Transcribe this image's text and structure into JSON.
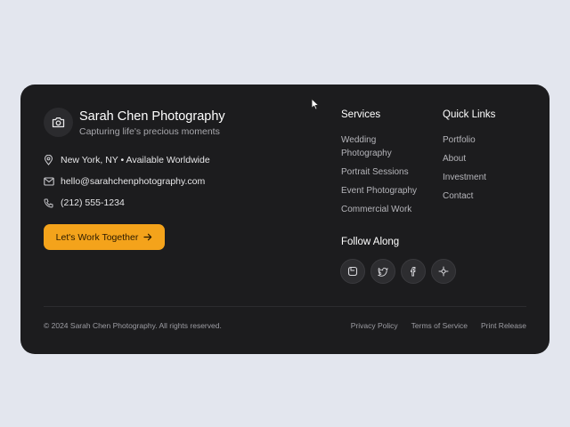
{
  "brand": {
    "icon": "camera-icon",
    "name": "Sarah Chen Photography",
    "tagline": "Capturing life's precious moments"
  },
  "contact": {
    "location": "New York, NY • Available Worldwide",
    "email": "hello@sarahchenphotography.com",
    "phone": "(212) 555-1234"
  },
  "cta": {
    "label": "Let's Work Together",
    "icon": "arrow-right-icon"
  },
  "services": {
    "title": "Services",
    "items": [
      "Wedding",
      "Photography",
      "Portrait Sessions",
      "Event Photography",
      "Commercial Work"
    ]
  },
  "quick_links": {
    "title": "Quick Links",
    "items": [
      "Portfolio",
      "About",
      "Investment",
      "Contact"
    ]
  },
  "follow": {
    "title": "Follow Along",
    "icons": [
      "instagram-icon",
      "twitter-icon",
      "facebook-icon",
      "pinterest-icon"
    ]
  },
  "footer": {
    "copyright": "© 2024 Sarah Chen Photography. All rights reserved.",
    "links": [
      "Privacy Policy",
      "Terms of Service",
      "Print Release"
    ]
  },
  "colors": {
    "background": "#e3e6ee",
    "card": "#1c1c1e",
    "accent": "#f4a31b"
  }
}
